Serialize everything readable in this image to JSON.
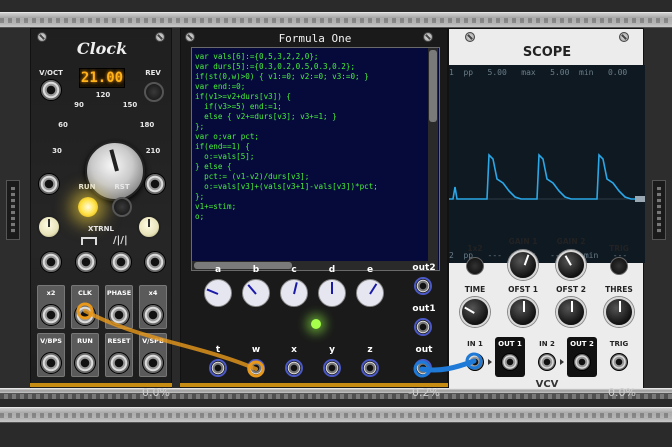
{
  "clock": {
    "title": "Clock",
    "voct_label": "V/OCT",
    "rev_label": "REV",
    "bpm_display": "21.00",
    "dial_ticks": [
      "30",
      "60",
      "90",
      "120",
      "150",
      "180",
      "210"
    ],
    "run_label": "RUN",
    "rst_label": "RST",
    "xtrnl_label": "XTRNL",
    "tiles": [
      "x2",
      "CLK",
      "PHASE",
      "x4",
      "V/BPS",
      "RUN",
      "RESET",
      "V/SPB"
    ],
    "cpu": "0.0%"
  },
  "formula": {
    "title": "Formula One",
    "code": "var vals[6]:={0,5,3,2,2,0};\nvar durs[5]:={0.3,0.2,0.5,0.3,0.2};\nif(st(0,w)>0) { v1:=0; v2:=0; v3:=0; }\nvar end:=0;\nif(v1>=v2+durs[v3]) {\n  if(v3>=5) end:=1;\n  else { v2+=durs[v3]; v3+=1; }\n};\nvar o;var pct;\nif(end==1) {\n  o:=vals[5];\n} else {\n  pct:= (v1-v2)/durs[v3];\n  o:=vals[v3]+(vals[v3+1]-vals[v3])*pct;\n};\nv1+=stim;\no;",
    "knob_labels": [
      "a",
      "b",
      "c",
      "d",
      "e"
    ],
    "knob_values": [
      0.25,
      0.35,
      0.55,
      0.5,
      0.62
    ],
    "input_labels": [
      "t",
      "w",
      "x",
      "y",
      "z"
    ],
    "out2_label": "out2",
    "out1_label": "out1",
    "out_label": "out",
    "cpu": "-0.2%"
  },
  "scope": {
    "title": "SCOPE",
    "top_bar": "1  pp   5.00   max   5.00  min   0.00",
    "bottom_bar": "2  pp   ---    max   ---    min   ---",
    "labels": {
      "x2": "1x2",
      "gain1": "GAIN 1",
      "gain2": "GAIN 2",
      "trig": "TRIG",
      "time": "TIME",
      "ofst1": "OFST 1",
      "ofst2": "OFST 2",
      "thres": "THRES",
      "in1": "IN 1",
      "out1": "OUT 1",
      "in2": "IN 2",
      "out2": "OUT 2",
      "trig_in": "TRIG",
      "brand": "VCV"
    },
    "trace_color": "#2aa8e8",
    "cpu": "0.0%"
  },
  "colors": {
    "code_text": "#46f23c",
    "editor_bg": "#050a3a",
    "cable_orange": "#e8991c",
    "cable_blue": "#1e7ad6",
    "lcd_amber": "#ffb21a"
  }
}
